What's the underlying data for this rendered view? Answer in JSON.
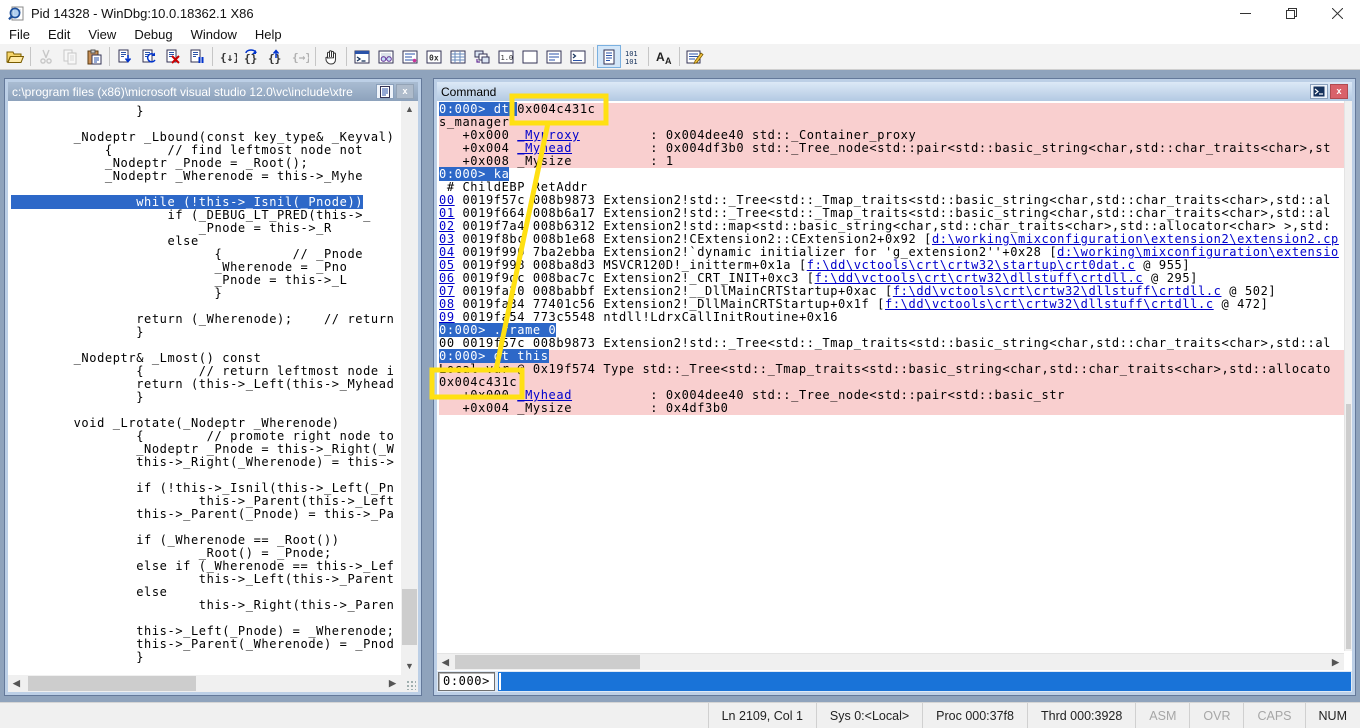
{
  "window": {
    "title": "Pid 14328 - WinDbg:10.0.18362.1 X86"
  },
  "menu": [
    "File",
    "Edit",
    "View",
    "Debug",
    "Window",
    "Help"
  ],
  "toolbar": [
    {
      "name": "open-workspace-button",
      "icon": "open"
    },
    {
      "sep": true
    },
    {
      "name": "cut-button",
      "icon": "cut",
      "disabled": true
    },
    {
      "name": "copy-button",
      "icon": "copy",
      "disabled": true
    },
    {
      "name": "paste-button",
      "icon": "paste"
    },
    {
      "sep": true
    },
    {
      "name": "go-button",
      "icon": "go"
    },
    {
      "name": "restart-button",
      "icon": "restart"
    },
    {
      "name": "stop-debugging-button",
      "icon": "stop"
    },
    {
      "name": "break-button",
      "icon": "breakdoc"
    },
    {
      "sep": true
    },
    {
      "name": "step-into-button",
      "icon": "stepinto"
    },
    {
      "name": "step-over-button",
      "icon": "stepover"
    },
    {
      "name": "step-out-button",
      "icon": "stepout"
    },
    {
      "name": "run-to-cursor-button",
      "icon": "runcursor",
      "disabled": true
    },
    {
      "sep": true
    },
    {
      "name": "break-hand-button",
      "icon": "hand"
    },
    {
      "sep": true
    },
    {
      "name": "command-window-button",
      "icon": "terminal"
    },
    {
      "name": "watch-window-button",
      "icon": "watch"
    },
    {
      "name": "locals-window-button",
      "icon": "locals"
    },
    {
      "name": "registers-window-button",
      "icon": "regs"
    },
    {
      "name": "memory-window-button",
      "icon": "memory"
    },
    {
      "name": "call-stack-window-button",
      "icon": "calls"
    },
    {
      "name": "disassembly-window-button",
      "icon": "disasm"
    },
    {
      "name": "scratch-pad-button",
      "icon": "scratch"
    },
    {
      "name": "processes-window-button",
      "icon": "proc"
    },
    {
      "name": "command-browser-button",
      "icon": "cmdbrowse"
    },
    {
      "sep": true
    },
    {
      "name": "source-mode-button",
      "icon": "srcmode",
      "selected": true
    },
    {
      "name": "assembly-mode-button",
      "icon": "mem101"
    },
    {
      "sep": true
    },
    {
      "name": "font-button",
      "icon": "font"
    },
    {
      "sep": true
    },
    {
      "name": "options-button",
      "icon": "options"
    }
  ],
  "source_panel": {
    "title": "c:\\program files (x86)\\microsoft visual studio 12.0\\vc\\include\\xtre",
    "highlighted_line": 7,
    "lines": [
      "                }",
      "",
      "        _Nodeptr _Lbound(const key_type& _Keyval)",
      "            {       // find leftmost node not",
      "            _Nodeptr _Pnode = _Root();",
      "            _Nodeptr _Wherenode = this->_Myhe",
      "",
      "                while (!this->_Isnil(_Pnode))",
      "                    if (_DEBUG_LT_PRED(this->_",
      "                        _Pnode = this->_R",
      "                    else",
      "                          {         // _Pnode",
      "                          _Wherenode = _Pno",
      "                          _Pnode = this->_L",
      "                          }",
      "",
      "                return (_Wherenode);    // return",
      "                }",
      "",
      "        _Nodeptr& _Lmost() const",
      "                {       // return leftmost node i",
      "                return (this->_Left(this->_Myhead",
      "                }",
      "",
      "        void _Lrotate(_Nodeptr _Wherenode)",
      "                {        // promote right node to ",
      "                _Nodeptr _Pnode = this->_Right(_W",
      "                this->_Right(_Wherenode) = this->",
      "",
      "                if (!this->_Isnil(this->_Left(_Pn",
      "                        this->_Parent(this->_Left",
      "                this->_Parent(_Pnode) = this->_Pa",
      "",
      "                if (_Wherenode == _Root())",
      "                        _Root() = _Pnode;",
      "                else if (_Wherenode == this->_Lef",
      "                        this->_Left(this->_Parent",
      "                else",
      "                        this->_Right(this->_Paren",
      "",
      "                this->_Left(_Pnode) = _Wherenode;",
      "                this->_Parent(_Wherenode) = _Pnod",
      "                }"
    ]
  },
  "command_panel": {
    "title": "Command",
    "prompt": "0:000>",
    "input_value": "",
    "lines": [
      {
        "bg": "pink",
        "parts": [
          [
            "sel",
            "0:000> dt "
          ],
          [
            "boxed",
            "0x004c431c"
          ]
        ]
      },
      {
        "bg": "pink",
        "parts": [
          [
            "plain",
            "s_manager"
          ]
        ]
      },
      {
        "bg": "pink",
        "parts": [
          [
            "plain",
            "   +0x000 "
          ],
          [
            "link",
            "_Myproxy"
          ],
          [
            "plain",
            "         : 0x004dee40 std::_Container_proxy"
          ]
        ]
      },
      {
        "bg": "pink",
        "parts": [
          [
            "plain",
            "   +0x004 "
          ],
          [
            "link",
            "_Myhead"
          ],
          [
            "plain",
            "          : 0x004df3b0 std::_Tree_node<std::pair<std::basic_string<char,std::char_traits<char>,st"
          ]
        ]
      },
      {
        "bg": "pink",
        "parts": [
          [
            "plain",
            "   +0x008 _Mysize          : 1"
          ]
        ]
      },
      {
        "bg": "white",
        "parts": [
          [
            "sel",
            "0:000> ka"
          ]
        ]
      },
      {
        "bg": "white",
        "parts": [
          [
            "plain",
            " # ChildEBP RetAddr"
          ]
        ]
      },
      {
        "bg": "white",
        "parts": [
          [
            "link",
            "00"
          ],
          [
            "plain",
            " 0019f57c 008b9873 Extension2!std::_Tree<std::_Tmap_traits<std::basic_string<char,std::char_traits<char>,std::al"
          ]
        ]
      },
      {
        "bg": "white",
        "parts": [
          [
            "link",
            "01"
          ],
          [
            "plain",
            " 0019f664 008b6a17 Extension2!std::_Tree<std::_Tmap_traits<std::basic_string<char,std::char_traits<char>,std::al"
          ]
        ]
      },
      {
        "bg": "white",
        "parts": [
          [
            "link",
            "02"
          ],
          [
            "plain",
            " 0019f7a4 008b6312 Extension2!std::map<std::basic_string<char,std::char_traits<char>,std::allocator<char> >,std:"
          ]
        ]
      },
      {
        "bg": "white",
        "parts": [
          [
            "link",
            "03"
          ],
          [
            "plain",
            " 0019f8bc 008b1e68 Extension2!CExtension2::CExtension2+0x92 ["
          ],
          [
            "link",
            "d:\\working\\mixconfiguration\\extension2\\extension2.cp"
          ]
        ]
      },
      {
        "bg": "white",
        "parts": [
          [
            "link",
            "04"
          ],
          [
            "plain",
            " 0019f990 7ba2ebba Extension2!`dynamic initializer for 'g_extension2''+0x28 ["
          ],
          [
            "link",
            "d:\\working\\mixconfiguration\\extensio"
          ]
        ]
      },
      {
        "bg": "white",
        "parts": [
          [
            "link",
            "05"
          ],
          [
            "plain",
            " 0019f998 008ba8d3 MSVCR120D!_initterm+0x1a ["
          ],
          [
            "link",
            "f:\\dd\\vctools\\crt\\crtw32\\startup\\crt0dat.c"
          ],
          [
            "plain",
            " @ 955]"
          ]
        ]
      },
      {
        "bg": "white",
        "parts": [
          [
            "link",
            "06"
          ],
          [
            "plain",
            " 0019f9dc 008bac7c Extension2!_CRT_INIT+0xc3 ["
          ],
          [
            "link",
            "f:\\dd\\vctools\\crt\\crtw32\\dllstuff\\crtdll.c"
          ],
          [
            "plain",
            " @ 295]"
          ]
        ]
      },
      {
        "bg": "white",
        "parts": [
          [
            "link",
            "07"
          ],
          [
            "plain",
            " 0019fa20 008babbf Extension2!__DllMainCRTStartup+0xac ["
          ],
          [
            "link",
            "f:\\dd\\vctools\\crt\\crtw32\\dllstuff\\crtdll.c"
          ],
          [
            "plain",
            " @ 502]"
          ]
        ]
      },
      {
        "bg": "white",
        "parts": [
          [
            "link",
            "08"
          ],
          [
            "plain",
            " 0019fa34 77401c56 Extension2!_DllMainCRTStartup+0x1f ["
          ],
          [
            "link",
            "f:\\dd\\vctools\\crt\\crtw32\\dllstuff\\crtdll.c"
          ],
          [
            "plain",
            " @ 472]"
          ]
        ]
      },
      {
        "bg": "white",
        "parts": [
          [
            "link",
            "09"
          ],
          [
            "plain",
            " 0019fa54 773c5548 ntdll!LdrxCallInitRoutine+0x16"
          ]
        ]
      },
      {
        "bg": "white",
        "parts": [
          [
            "sel",
            "0:000> .frame 0"
          ]
        ]
      },
      {
        "bg": "white",
        "parts": [
          [
            "plain",
            "00 0019f57c 008b9873 Extension2!std::_Tree<std::_Tmap_traits<std::basic_string<char,std::char_traits<char>,std::al"
          ]
        ]
      },
      {
        "bg": "pink",
        "parts": [
          [
            "sel",
            "0:000> dt this"
          ]
        ]
      },
      {
        "bg": "pink",
        "parts": [
          [
            "plain",
            "Local var @ 0x19f574 Type std::_Tree<std::_Tmap_traits<std::basic_string<char,std::char_traits<char>,std::allocato"
          ]
        ]
      },
      {
        "bg": "pink",
        "parts": [
          [
            "boxed",
            "0x004c431c"
          ]
        ]
      },
      {
        "bg": "pink",
        "parts": [
          [
            "plain",
            "   +0x000 "
          ],
          [
            "link",
            "_Myhead"
          ],
          [
            "plain",
            "          : 0x004dee40 std::_Tree_node<std::pair<std::basic_str"
          ]
        ]
      },
      {
        "bg": "pink",
        "parts": [
          [
            "plain",
            "   +0x004 _Mysize          : 0x4df3b0"
          ]
        ]
      }
    ]
  },
  "status_bar": [
    {
      "name": "caret-position",
      "label": "Ln 2109, Col 1",
      "dim": false
    },
    {
      "name": "system-status",
      "label": "Sys 0:<Local>",
      "dim": false
    },
    {
      "name": "process-id",
      "label": "Proc 000:37f8",
      "dim": false
    },
    {
      "name": "thread-id",
      "label": "Thrd 000:3928",
      "dim": false
    },
    {
      "name": "asm-indicator",
      "label": "ASM",
      "dim": true
    },
    {
      "name": "ovr-indicator",
      "label": "OVR",
      "dim": true
    },
    {
      "name": "caps-indicator",
      "label": "CAPS",
      "dim": true
    },
    {
      "name": "num-indicator",
      "label": "NUM",
      "dim": false
    }
  ],
  "colors": {
    "selection": "#2d68c8",
    "pink_highlight": "#f9cfcf",
    "link": "#0000cc",
    "annotation_yellow": "#ffe012",
    "input_selection": "#1973d8"
  }
}
